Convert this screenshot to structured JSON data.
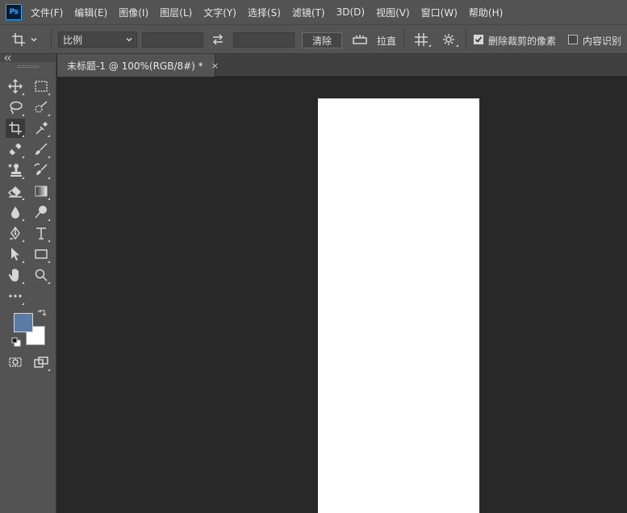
{
  "app": {
    "logo_text": "Ps"
  },
  "menu": [
    "文件(F)",
    "编辑(E)",
    "图像(I)",
    "图层(L)",
    "文字(Y)",
    "选择(S)",
    "滤镜(T)",
    "3D(D)",
    "视图(V)",
    "窗口(W)",
    "帮助(H)"
  ],
  "options": {
    "ratio_value": "比例",
    "width_value": "",
    "height_value": "",
    "clear_label": "清除",
    "straighten_label": "拉直",
    "delete_cropped_label": "删除裁剪的像素",
    "delete_cropped_checked": true,
    "content_aware_label": "内容识别",
    "content_aware_checked": false
  },
  "document": {
    "tab_title": "未标题-1 @ 100%(RGB/8#) *",
    "close_glyph": "×"
  },
  "colors": {
    "foreground": "#5a7ba6",
    "background": "#ffffff",
    "ui_panel": "#535353",
    "workspace": "#282828"
  },
  "tools": [
    "move-icon",
    "marquee-icon",
    "lasso-icon",
    "quick-select-icon",
    "crop-icon",
    "eyedropper-icon",
    "healing-icon",
    "brush-icon",
    "stamp-icon",
    "history-brush-icon",
    "eraser-icon",
    "gradient-icon",
    "blur-icon",
    "dodge-icon",
    "pen-icon",
    "type-icon",
    "path-select-icon",
    "rectangle-icon",
    "hand-icon",
    "zoom-icon",
    "more-tools-icon",
    "quick-mask-icon",
    "screen-mode-icon"
  ]
}
